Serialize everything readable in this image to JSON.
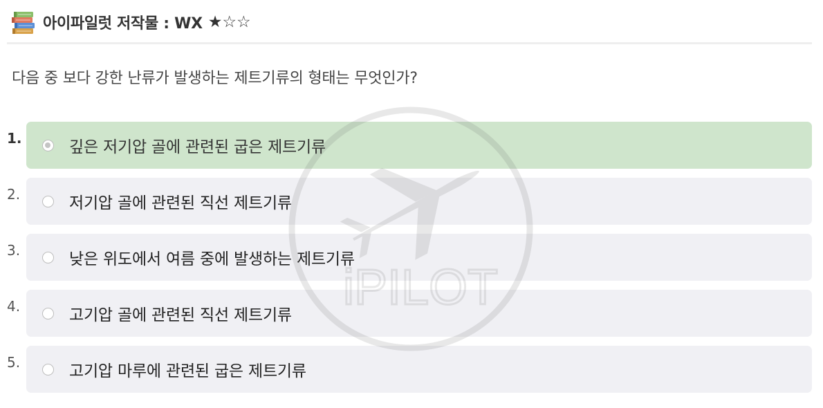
{
  "header": {
    "title": "아이파일럿 저작물 : WX",
    "stars": "★☆☆",
    "icon": "books-icon"
  },
  "question": "다음 중 보다 강한 난류가 발생하는 제트기류의 형태는 무엇인가?",
  "options": [
    {
      "number": "1.",
      "text": "깊은 저기압 골에 관련된 굽은 제트기류",
      "correct": true,
      "selected": true
    },
    {
      "number": "2.",
      "text": "저기압 골에 관련된 직선 제트기류",
      "correct": false,
      "selected": false
    },
    {
      "number": "3.",
      "text": "낮은 위도에서 여름 중에 발생하는 제트기류",
      "correct": false,
      "selected": false
    },
    {
      "number": "4.",
      "text": "고기압 골에 관련된 직선 제트기류",
      "correct": false,
      "selected": false
    },
    {
      "number": "5.",
      "text": "고기압 마루에 관련된 굽은 제트기류",
      "correct": false,
      "selected": false
    }
  ],
  "watermark": {
    "text": "iPILOT"
  },
  "colors": {
    "correct_bg": "#cfe5cc",
    "option_bg": "#f0f0f4",
    "divider": "#eeeeee"
  }
}
